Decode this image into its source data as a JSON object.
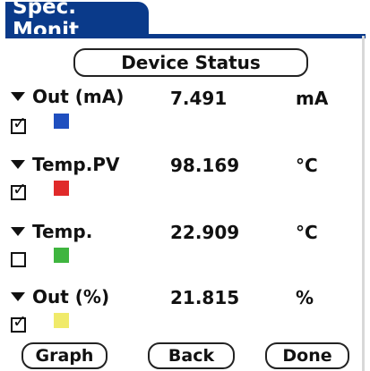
{
  "app": {
    "title": "Spec. Monit"
  },
  "device_status_label": "Device Status",
  "rows": [
    {
      "label": "Out (mA)",
      "value": "7.491",
      "unit": "mA",
      "checked": true,
      "color": "#1f4fbf"
    },
    {
      "label": "Temp.PV",
      "value": "98.169",
      "unit": "°C",
      "checked": true,
      "color": "#e02a2a"
    },
    {
      "label": "Temp.",
      "value": "22.909",
      "unit": "°C",
      "checked": false,
      "color": "#3fb53f"
    },
    {
      "label": "Out (%)",
      "value": "21.815",
      "unit": "%",
      "checked": true,
      "color": "#f0ea6a"
    }
  ],
  "buttons": {
    "graph": "Graph",
    "back": "Back",
    "done": "Done"
  },
  "colors": {
    "title_bar": "#0a3a8a"
  },
  "icons": {
    "dropdown": "triangle-down-icon",
    "checkbox_checked": "check-mark"
  }
}
